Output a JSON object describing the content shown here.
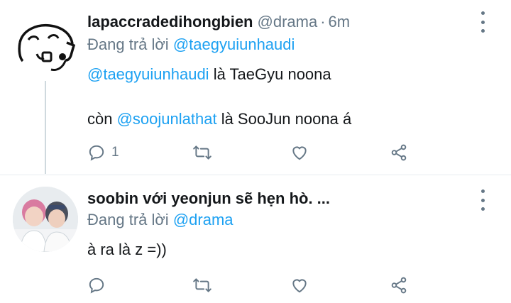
{
  "tweets": [
    {
      "name": "lapaccradedihongbien",
      "handle": "@drama",
      "dot": "·",
      "time": "6m",
      "reply_prefix": "Đang trả lời",
      "reply_to": "@taegyuiunhaudi",
      "line1_mention": "@taegyuiunhaudi",
      "line1_text": " là TaeGyu noona",
      "line2_prefix": "còn ",
      "line2_mention": "@soojunlathat",
      "line2_text": " là SooJun noona á",
      "reply_count": "1",
      "avatar_icon": "doodle-face-avatar"
    },
    {
      "name": "soobin với yeonjun sẽ hẹn hò. ...",
      "reply_prefix": "Đang trả lời",
      "reply_to": "@drama",
      "text": "à ra là z =))",
      "reply_count": "",
      "avatar_icon": "two-people-photo-avatar"
    }
  ],
  "icons": [
    "reply-icon",
    "retweet-icon",
    "like-icon",
    "share-icon",
    "more-options-icon"
  ],
  "colors": {
    "mention": "#1da1f2",
    "secondary": "#657786",
    "primary_text": "#14171a",
    "thread_line": "#cfd9de"
  }
}
